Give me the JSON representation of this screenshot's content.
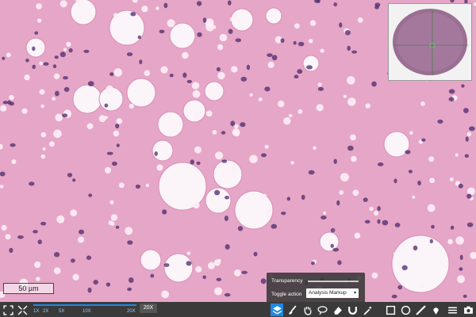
{
  "viewer": {
    "scale_label": "50 µm",
    "zoom_badge": "20X",
    "zoom_ticks": [
      "1X",
      "2X",
      "5X",
      "10X",
      "20X"
    ],
    "current_zoom": "20X"
  },
  "overlay_panel": {
    "transparency_label": "Transparency",
    "toggle_label": "Toggle action",
    "toggle_value": "Analysis Markup"
  },
  "toolbar": {
    "icons": [
      "fullscreen-icon",
      "fit-icon",
      "layers-icon",
      "brush-icon",
      "hand-icon",
      "lasso-icon",
      "eraser-icon",
      "magnet-icon",
      "square-icon",
      "circle-icon",
      "line-icon",
      "ruler-icon",
      "pin-icon",
      "settings-icon",
      "camera-icon"
    ]
  },
  "colors": {
    "tissue": "#e8a9c9",
    "nucleus": "#4b2a6b",
    "accent": "#1e88e5",
    "toolbar_bg": "#3a3a3a"
  }
}
